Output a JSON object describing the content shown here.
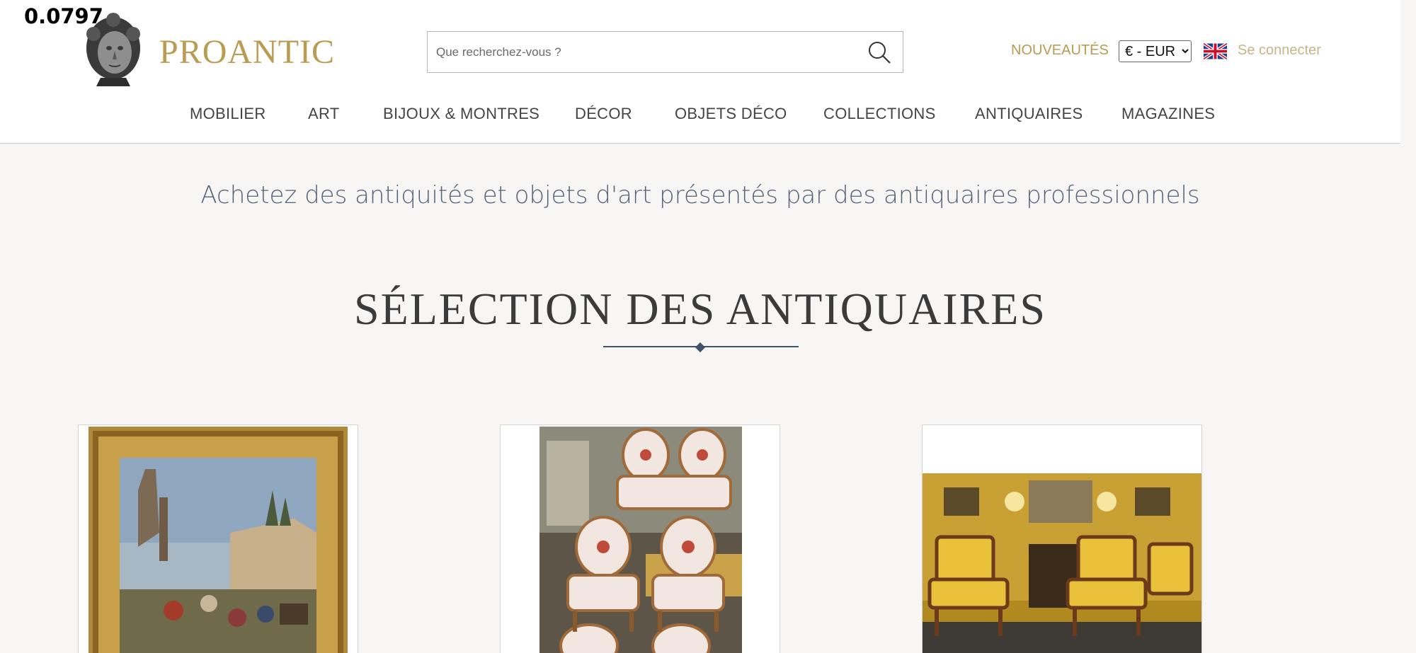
{
  "overlay": {
    "value": "0.0797"
  },
  "header": {
    "brand": "PROANTIC",
    "search_placeholder": "Que recherchez-vous ?",
    "new_link": "NOUVEAUTÉS",
    "currency": {
      "selected": "€ - EUR"
    },
    "language_icon": "uk-flag-icon",
    "login": "Se connecter"
  },
  "nav": {
    "items": [
      "MOBILIER",
      "ART",
      "BIJOUX & MONTRES",
      "DÉCOR",
      "OBJETS DÉCO",
      "COLLECTIONS",
      "ANTIQUAIRES",
      "MAGAZINES"
    ]
  },
  "main": {
    "tagline": "Achetez des antiquités et objets d'art présentés par des antiquaires professionnels",
    "section_title": "SÉLECTION DES ANTIQUAIRES"
  },
  "colors": {
    "brand_gold": "#b99b52",
    "login_gold": "#c7b58a",
    "tagline_blue": "#55637a",
    "rule_blue": "#3f536b",
    "page_bg": "#f7f6f4"
  }
}
